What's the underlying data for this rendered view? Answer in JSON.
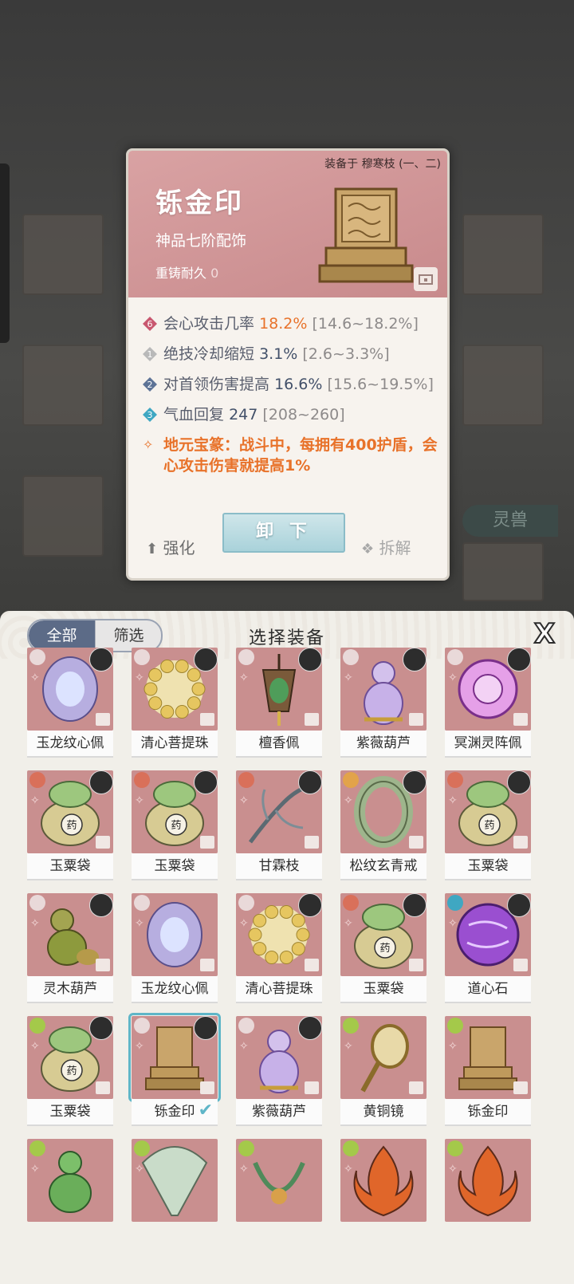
{
  "tooltip": {
    "equipped_to": "装备于 穆寒枝 (一、二)",
    "name": "铄金印",
    "grade": "神品七阶配饰",
    "recast_label": "重铸耐久",
    "recast_value": "0",
    "stats": [
      {
        "badge": "6",
        "badge_color": "#c8576f",
        "label": "会心攻击几率",
        "value": "18.2%",
        "hot": true,
        "range": "[14.6~18.2%]"
      },
      {
        "badge": "1",
        "badge_color": "#b9b9b9",
        "label": "绝技冷却缩短",
        "value": "3.1%",
        "hot": false,
        "range": "[2.6~3.3%]"
      },
      {
        "badge": "2",
        "badge_color": "#5d7396",
        "label": "对首领伤害提高",
        "value": "16.6%",
        "hot": false,
        "range": "[15.6~19.5%]"
      },
      {
        "badge": "3",
        "badge_color": "#3fa7c2",
        "label": "气血回复",
        "value": "247",
        "hot": false,
        "range": "[208~260]"
      }
    ],
    "skill": "地元宝篆：战斗中，每拥有400护盾，会心攻击伤害就提高1%",
    "btn_enhance": "强化",
    "btn_unequip": "卸 下",
    "btn_dismantle": "拆解"
  },
  "background": {
    "beast_tab": "灵兽"
  },
  "panel": {
    "tab_all": "全部",
    "tab_filter": "筛选",
    "title": "选择装备",
    "close": "X"
  },
  "items": [
    {
      "name": "玉龙纹心佩",
      "tier_color": "#e9d9d9",
      "art": "jade",
      "avatar": true
    },
    {
      "name": "清心菩提珠",
      "tier_color": "#e9d9d9",
      "art": "beads",
      "avatar": true
    },
    {
      "name": "檀香佩",
      "tier_color": "#e9d9d9",
      "art": "pendant",
      "avatar": true
    },
    {
      "name": "紫薇葫芦",
      "tier_color": "#e9d9d9",
      "art": "gourd-purple",
      "avatar": true
    },
    {
      "name": "冥渊灵阵佩",
      "tier_color": "#e9d9d9",
      "art": "disc-pink",
      "avatar": true
    },
    {
      "name": "玉粟袋",
      "tier_color": "#d9705a",
      "art": "bag",
      "avatar": true
    },
    {
      "name": "玉粟袋",
      "tier_color": "#d9705a",
      "art": "bag",
      "avatar": true
    },
    {
      "name": "甘霖枝",
      "tier_color": "#d9705a",
      "art": "branch",
      "avatar": true
    },
    {
      "name": "松纹玄青戒",
      "tier_color": "#e2a34a",
      "art": "ring",
      "avatar": true
    },
    {
      "name": "玉粟袋",
      "tier_color": "#d9705a",
      "art": "bag",
      "avatar": true
    },
    {
      "name": "灵木葫芦",
      "tier_color": "#e9d9d9",
      "art": "gourd-green",
      "avatar": true
    },
    {
      "name": "玉龙纹心佩",
      "tier_color": "#e9d9d9",
      "art": "jade",
      "avatar": false
    },
    {
      "name": "清心菩提珠",
      "tier_color": "#e9d9d9",
      "art": "beads",
      "avatar": true
    },
    {
      "name": "玉粟袋",
      "tier_color": "#d9705a",
      "art": "bag",
      "avatar": true
    },
    {
      "name": "道心石",
      "tier_color": "#3fa7c2",
      "art": "orb",
      "avatar": true
    },
    {
      "name": "玉粟袋",
      "tier_color": "#a4c94a",
      "art": "bag",
      "avatar": true
    },
    {
      "name": "铄金印",
      "tier_color": "#e9d9d9",
      "art": "seal",
      "avatar": true,
      "selected": true
    },
    {
      "name": "紫薇葫芦",
      "tier_color": "#e9d9d9",
      "art": "gourd-purple",
      "avatar": true
    },
    {
      "name": "黄铜镜",
      "tier_color": "#a4c94a",
      "art": "mirror",
      "avatar": false
    },
    {
      "name": "铄金印",
      "tier_color": "#a4c94a",
      "art": "seal",
      "avatar": false
    },
    {
      "name": "",
      "tier_color": "#a4c94a",
      "art": "gourd-green2",
      "avatar": false
    },
    {
      "name": "",
      "tier_color": "#a4c94a",
      "art": "fan",
      "avatar": false
    },
    {
      "name": "",
      "tier_color": "#a4c94a",
      "art": "necklace",
      "avatar": false
    },
    {
      "name": "",
      "tier_color": "#a4c94a",
      "art": "flame",
      "avatar": false
    },
    {
      "name": "",
      "tier_color": "#a4c94a",
      "art": "flame",
      "avatar": false
    }
  ]
}
